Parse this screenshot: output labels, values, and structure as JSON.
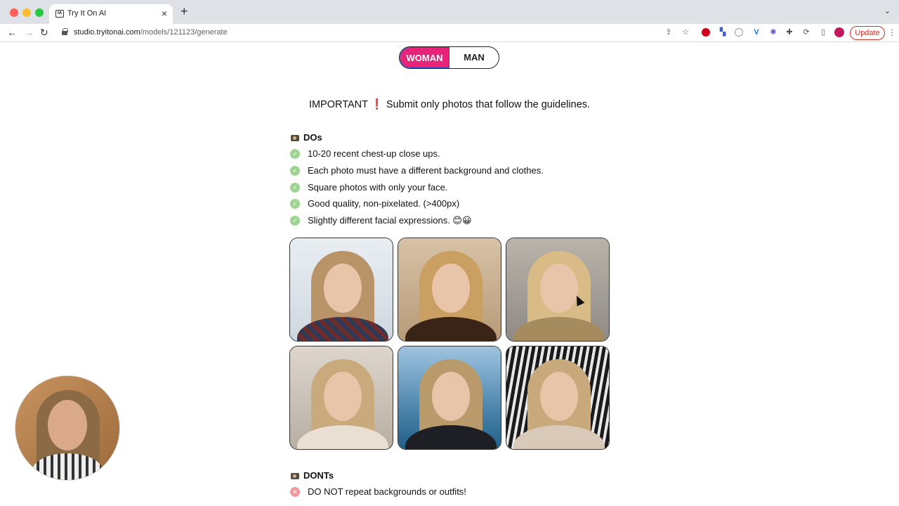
{
  "browser": {
    "tab_title": "Try It On AI",
    "favicon_text": "tA",
    "url_host": "studio.tryitonai.com",
    "url_path": "/models/121123/generate",
    "update_label": "Update"
  },
  "gender_toggle": {
    "options": [
      "WOMAN",
      "MAN"
    ],
    "selected": "WOMAN",
    "accent": "#e8237a"
  },
  "important": {
    "lead": "IMPORTANT",
    "mark": "❗",
    "text": "Submit only photos that follow the guidelines."
  },
  "dos": {
    "title": "DOs",
    "items": [
      "10-20 recent chest-up close ups.",
      "Each photo must have a different background and clothes.",
      "Square photos with only your face.",
      "Good quality, non-pixelated. (>400px)",
      "Slightly different facial expressions. 😊😀"
    ]
  },
  "donts": {
    "title": "DONTs",
    "items": [
      "DO NOT repeat backgrounds or outfits!"
    ]
  },
  "colors": {
    "check_green": "#9ed491",
    "cross_red": "#f29a9a"
  }
}
